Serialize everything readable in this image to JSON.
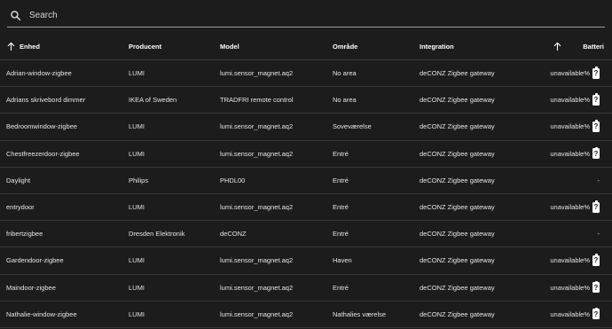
{
  "search": {
    "placeholder": "Search"
  },
  "columns": {
    "name": "Enhed",
    "manufacturer": "Producent",
    "model": "Model",
    "area": "Område",
    "integration": "Integration",
    "battery": "Batteri"
  },
  "rows": [
    {
      "name": "Adrian-window-zigbee",
      "manufacturer": "LUMI",
      "model": "lumi.sensor_magnet.aq2",
      "area": "No area",
      "integration": "deCONZ Zigbee gateway",
      "battery": "unavailable%",
      "battery_icon": "battery-unknown-icon"
    },
    {
      "name": "Adrians skrivebord dimmer",
      "manufacturer": "IKEA of Sweden",
      "model": "TRADFRI remote control",
      "area": "No area",
      "integration": "deCONZ Zigbee gateway",
      "battery": "unavailable%",
      "battery_icon": "battery-unknown-icon"
    },
    {
      "name": "Bedroomwindow-zigbee",
      "manufacturer": "LUMI",
      "model": "lumi.sensor_magnet.aq2",
      "area": "Soveværelse",
      "integration": "deCONZ Zigbee gateway",
      "battery": "unavailable%",
      "battery_icon": "battery-unknown-icon"
    },
    {
      "name": "Chestfreezerdoor-zigbee",
      "manufacturer": "LUMI",
      "model": "lumi.sensor_magnet.aq2",
      "area": "Entré",
      "integration": "deCONZ Zigbee gateway",
      "battery": "unavailable%",
      "battery_icon": "battery-unknown-icon"
    },
    {
      "name": "Daylight",
      "manufacturer": "Philips",
      "model": "PHDL00",
      "area": "Entré",
      "integration": "deCONZ Zigbee gateway",
      "battery": "-",
      "battery_icon": ""
    },
    {
      "name": "entrydoor",
      "manufacturer": "LUMI",
      "model": "lumi.sensor_magnet.aq2",
      "area": "Entré",
      "integration": "deCONZ Zigbee gateway",
      "battery": "unavailable%",
      "battery_icon": "battery-unknown-icon"
    },
    {
      "name": "fribertzigbee",
      "manufacturer": "Dresden Elektronik",
      "model": "deCONZ",
      "area": "Entré",
      "integration": "deCONZ Zigbee gateway",
      "battery": "-",
      "battery_icon": ""
    },
    {
      "name": "Gardendoor-zigbee",
      "manufacturer": "LUMI",
      "model": "lumi.sensor_magnet.aq2",
      "area": "Haven",
      "integration": "deCONZ Zigbee gateway",
      "battery": "unavailable%",
      "battery_icon": "battery-unknown-icon"
    },
    {
      "name": "Maindoor-zigbee",
      "manufacturer": "LUMI",
      "model": "lumi.sensor_magnet.aq2",
      "area": "Entré",
      "integration": "deCONZ Zigbee gateway",
      "battery": "unavailable%",
      "battery_icon": "battery-unknown-icon"
    },
    {
      "name": "Nathalie-window-zigbee",
      "manufacturer": "LUMI",
      "model": "lumi.sensor_magnet.aq2",
      "area": "Nathalies værelse",
      "integration": "deCONZ Zigbee gateway",
      "battery": "unavailable%",
      "battery_icon": "battery-unknown-icon"
    }
  ]
}
